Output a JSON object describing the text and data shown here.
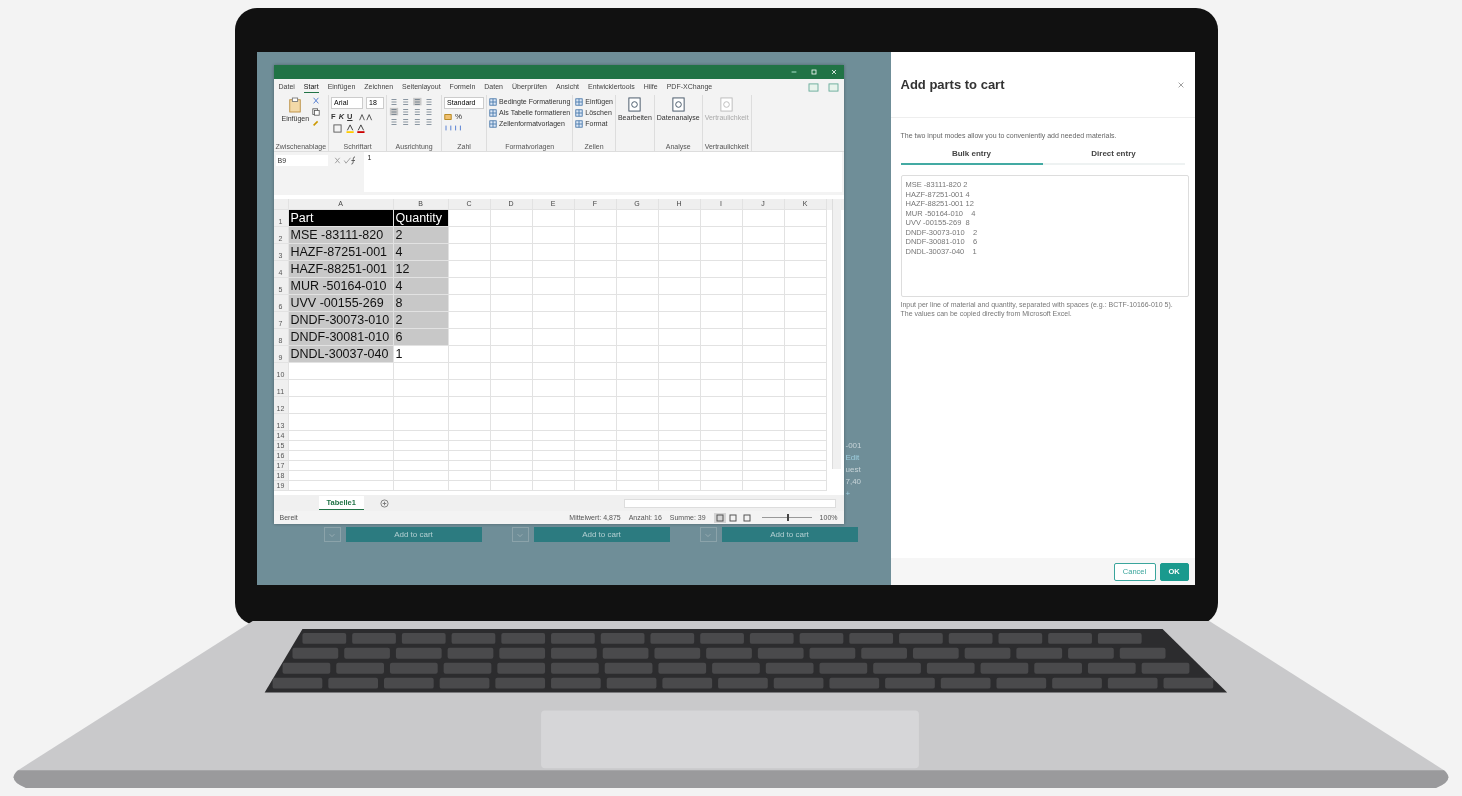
{
  "background_app": {
    "fragments": [
      {
        "text": "-001",
        "kind": "text"
      },
      {
        "text": "Edit",
        "kind": "link"
      },
      {
        "text": "uest",
        "kind": "text"
      },
      {
        "text": "7,40",
        "kind": "text"
      },
      {
        "text": "+",
        "kind": "link"
      }
    ],
    "cart_buttons": [
      {
        "label": "Add to cart"
      },
      {
        "label": "Add to cart"
      },
      {
        "label": "Add to cart"
      }
    ]
  },
  "excel": {
    "menu_tabs": [
      {
        "label": "Datei",
        "selected": false
      },
      {
        "label": "Start",
        "selected": true
      },
      {
        "label": "Einfügen",
        "selected": false
      },
      {
        "label": "Zeichnen",
        "selected": false
      },
      {
        "label": "Seitenlayout",
        "selected": false
      },
      {
        "label": "Formeln",
        "selected": false
      },
      {
        "label": "Daten",
        "selected": false
      },
      {
        "label": "Überprüfen",
        "selected": false
      },
      {
        "label": "Ansicht",
        "selected": false
      },
      {
        "label": "Entwicklertools",
        "selected": false
      },
      {
        "label": "Hilfe",
        "selected": false
      },
      {
        "label": "PDF-XChange",
        "selected": false
      }
    ],
    "ribbon_groups": [
      {
        "kind": "clipboard",
        "label": "Zwischenablage",
        "button": "Einfügen"
      },
      {
        "kind": "font",
        "label": "Schriftart",
        "font": "Arial",
        "size": "18",
        "styles": [
          "F",
          "K",
          "U"
        ]
      },
      {
        "kind": "alignment",
        "label": "Ausrichtung"
      },
      {
        "kind": "number",
        "label": "Zahl",
        "format": "Standard",
        "symbol": "%"
      },
      {
        "kind": "list",
        "label": "Formatvorlagen",
        "items": [
          "Bedingte Formatierung",
          "Als Tabelle formatieren",
          "Zellenformatvorlagen"
        ]
      },
      {
        "kind": "list",
        "label": "Zellen",
        "items": [
          "Einfügen",
          "Löschen",
          "Format"
        ]
      },
      {
        "kind": "big",
        "button": "Bearbeiten",
        "disabled": false
      },
      {
        "kind": "big",
        "label": "Analyse",
        "button": "Datenanalyse",
        "disabled": false
      },
      {
        "kind": "big",
        "label": "Vertraulichkeit",
        "button": "Vertraulichkeit",
        "disabled": true
      }
    ],
    "name_box": "B9",
    "formula": "1",
    "columns": [
      "A",
      "B",
      "C",
      "D",
      "E",
      "F",
      "G",
      "H",
      "I",
      "J",
      "K"
    ],
    "rows": [
      {
        "num": "1",
        "part": "Part",
        "quantity": "Quantity",
        "kind": "header",
        "active": false
      },
      {
        "num": "2",
        "part": "MSE -83111-820",
        "quantity": "2",
        "kind": "data",
        "active": false
      },
      {
        "num": "3",
        "part": "HAZF-87251-001",
        "quantity": "4",
        "kind": "data",
        "active": false
      },
      {
        "num": "4",
        "part": "HAZF-88251-001",
        "quantity": "12",
        "kind": "data",
        "active": false
      },
      {
        "num": "5",
        "part": "MUR -50164-010",
        "quantity": "4",
        "kind": "data",
        "active": false
      },
      {
        "num": "6",
        "part": "UVV -00155-269",
        "quantity": "8",
        "kind": "data",
        "active": false
      },
      {
        "num": "7",
        "part": "DNDF-30073-010",
        "quantity": "2",
        "kind": "data",
        "active": false
      },
      {
        "num": "8",
        "part": "DNDF-30081-010",
        "quantity": "6",
        "kind": "data",
        "active": false
      },
      {
        "num": "9",
        "part": "DNDL-30037-040",
        "quantity": "1",
        "kind": "data",
        "active": true
      }
    ],
    "empty_rows": [
      "10",
      "11",
      "12",
      "13",
      "14",
      "15",
      "16",
      "17",
      "18",
      "19"
    ],
    "sheet_tabs": [
      {
        "label": "Tabelle1",
        "selected": true
      }
    ],
    "status": {
      "ready": "Bereit",
      "stats": [
        "Mittelwert: 4,875",
        "Anzahl: 16",
        "Summe: 39"
      ],
      "zoom_slider": {
        "level": 0.5
      },
      "zoom": "100%"
    }
  },
  "dialog": {
    "title": "Add parts to cart",
    "description": "The two input modes allow you to conveniently add needed materials.",
    "tabs": [
      {
        "label": "Bulk entry",
        "selected": true
      },
      {
        "label": "Direct entry",
        "selected": false
      }
    ],
    "textarea_value": "MSE -83111-820 2\nHAZF-87251-001 4\nHAZF-88251-001 12\nMUR -50164-010    4\nUVV -00155-269  8\nDNDF-30073-010    2\nDNDF-30081-010    6\nDNDL-30037-040    1",
    "hint": "Input per line of material and quantity, separated with spaces (e.g.: BCTF-10166-010 5). The values can be copied directly from Microsoft Excel.",
    "buttons": [
      {
        "label": "Cancel",
        "kind": "secondary"
      },
      {
        "label": "OK",
        "kind": "primary"
      }
    ]
  }
}
